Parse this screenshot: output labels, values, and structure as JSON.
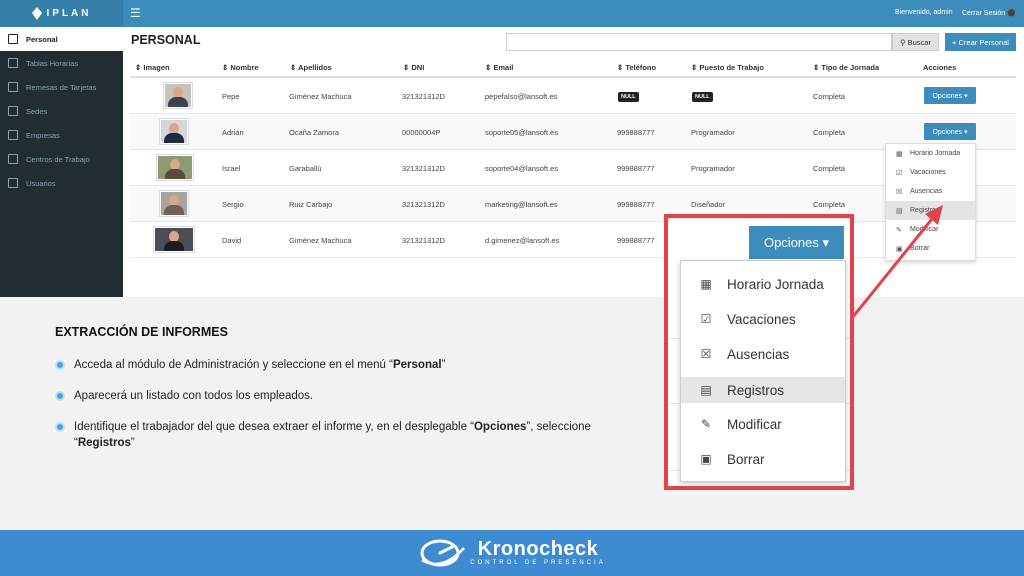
{
  "app": {
    "logo": "IPLAN",
    "welcome": "Bienvenido, admin",
    "logout": "Cerrar Sesión",
    "sidebar": [
      {
        "label": "Personal",
        "active": true
      },
      {
        "label": "Tablas Horarias"
      },
      {
        "label": "Remesas de Tarjetas"
      },
      {
        "label": "Sedes"
      },
      {
        "label": "Empresas"
      },
      {
        "label": "Centros de Trabajo"
      },
      {
        "label": "Usuarios"
      }
    ],
    "page_title": "PERSONAL",
    "search": {
      "value": "",
      "button": "Buscar"
    },
    "create_button": "+ Crear Personal",
    "columns": [
      "Imagen",
      "Nombre",
      "Apellidos",
      "DNI",
      "Email",
      "Teléfono",
      "Puesto de Trabajo",
      "Tipo de Jornada",
      "Acciones"
    ],
    "rows": [
      {
        "nombre": "Pepe",
        "apellidos": "Giménez Machuca",
        "dni": "321321312D",
        "email": "pepefalso@lansoft.es",
        "telefono": "NULL",
        "puesto": "NULL",
        "jornada": "Completa"
      },
      {
        "nombre": "Adrián",
        "apellidos": "Ocaña Zamora",
        "dni": "00000004P",
        "email": "soporte05@lansoft.es",
        "telefono": "999888777",
        "puesto": "Programador",
        "jornada": "Completa"
      },
      {
        "nombre": "Israel",
        "apellidos": "Garaballú",
        "dni": "321321312D",
        "email": "soporte04@lansoft.es",
        "telefono": "999888777",
        "puesto": "Programador",
        "jornada": "Completa"
      },
      {
        "nombre": "Sergio",
        "apellidos": "Ruiz Carbajo",
        "dni": "321321312D",
        "email": "marketing@lansoft.es",
        "telefono": "999888777",
        "puesto": "Diseñador",
        "jornada": "Completa"
      },
      {
        "nombre": "David",
        "apellidos": "Giménez Machuca",
        "dni": "321321312D",
        "email": "d.gimenez@lansoft.es",
        "telefono": "999888777",
        "puesto": "",
        "jornada": ""
      }
    ],
    "options_button": "Opciones ▾",
    "menu": [
      "Horario Jornada",
      "Vacaciones",
      "Ausencias",
      "Registros",
      "Modificar",
      "Borrar"
    ],
    "menu_active": "Registros"
  },
  "instructions": {
    "title": "EXTRACCIÓN DE INFORMES",
    "b1_pre": "Acceda al módulo de Administración y seleccione en el menú “",
    "b1_bold": "Personal",
    "b1_post": "”",
    "b2": "Aparecerá un listado con todos los empleados.",
    "b3_pre": "Identifique el trabajador del que desea extraer el informe y, en el desplegable “",
    "b3_bold1": "Opciones",
    "b3_mid": "”, seleccione “",
    "b3_bold2": "Registros",
    "b3_post": "”"
  },
  "footer": {
    "brand": "Kronocheck",
    "tagline": "CONTROL DE PRESENCIA"
  },
  "colors": {
    "primary": "#3c8dbc",
    "sidebar": "#222d32",
    "highlight": "#e2434b",
    "footer": "#3f8bd1"
  }
}
